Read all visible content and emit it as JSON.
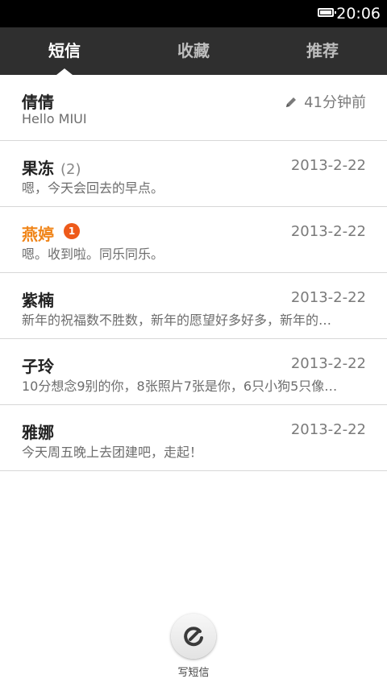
{
  "status_bar": {
    "time": "20:06"
  },
  "tabs": [
    {
      "label": "短信",
      "active": true
    },
    {
      "label": "收藏",
      "active": false
    },
    {
      "label": "推荐",
      "active": false
    }
  ],
  "threads": [
    {
      "name": "倩倩",
      "date": "41分钟前",
      "preview": "Hello MIUI",
      "draft": true
    },
    {
      "name": "果冻",
      "count": "(2)",
      "date": "2013-2-22",
      "preview": "嗯，今天会回去的早点。"
    },
    {
      "name": "燕婷",
      "badge": "1",
      "date": "2013-2-22",
      "preview": "嗯。收到啦。同乐同乐。",
      "unread": true
    },
    {
      "name": "紫楠",
      "date": "2013-2-22",
      "preview": "新年的祝福数不胜数，新年的愿望好多好多，新年的…"
    },
    {
      "name": "子玲",
      "date": "2013-2-22",
      "preview": "10分想念9别的你，8张照片7张是你，6只小狗5只像…"
    },
    {
      "name": "雅娜",
      "date": "2013-2-22",
      "preview": "今天周五晚上去团建吧，走起！"
    }
  ],
  "compose": {
    "label": "写短信",
    "icon": "compose-icon"
  },
  "colors": {
    "unread_name": "#f08519",
    "badge": "#ee5a1a",
    "tabbar": "#2f2f2f"
  }
}
